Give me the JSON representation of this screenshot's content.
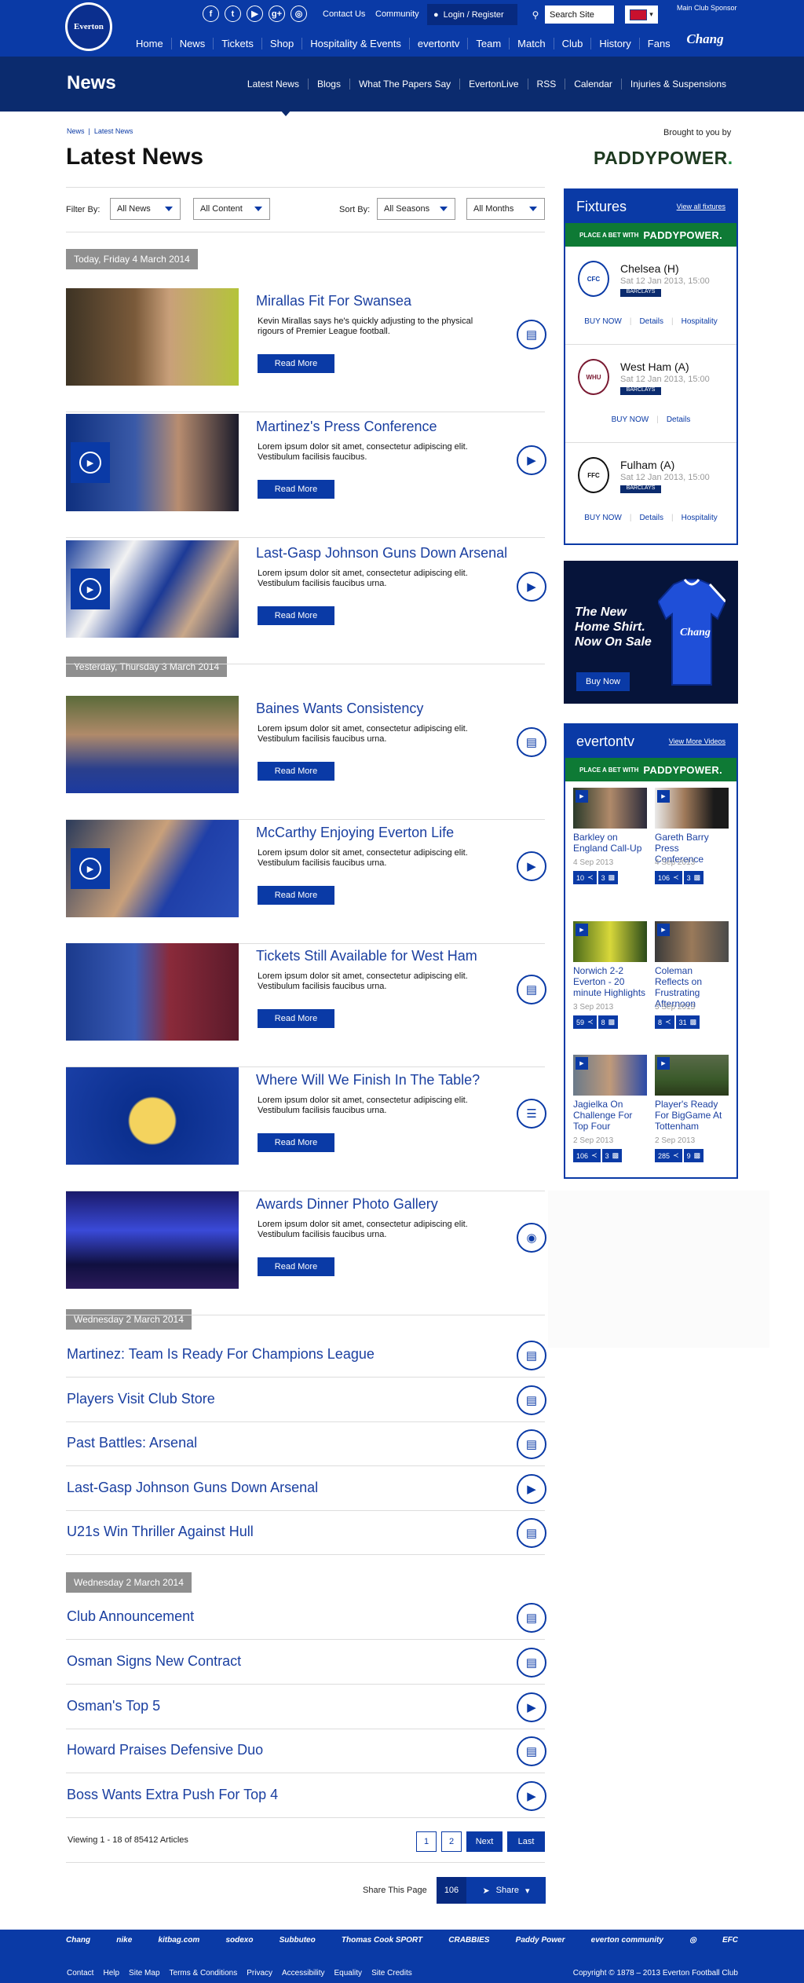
{
  "header": {
    "crest_text": "Everton",
    "social": [
      "f",
      "t",
      "▶",
      "g+",
      "◎"
    ],
    "contact_us": "Contact Us",
    "community": "Community",
    "login": "Login / Register",
    "search_placeholder": "Search Site",
    "sponsor_label": "Main Club Sponsor",
    "sponsor": "Chang",
    "nav": [
      "Home",
      "News",
      "Tickets",
      "Shop",
      "Hospitality & Events",
      "evertontv",
      "Team",
      "Match",
      "Club",
      "History",
      "Fans"
    ]
  },
  "section": {
    "title": "News",
    "subnav": [
      "Latest News",
      "Blogs",
      "What The Papers Say",
      "EvertonLive",
      "RSS",
      "Calendar",
      "Injuries & Suspensions"
    ]
  },
  "breadcrumb": {
    "home": "News",
    "current": "Latest News"
  },
  "page_title": "Latest News",
  "brought_by": "Brought to you by",
  "brand": {
    "a": "PADDY",
    "b": "POWER",
    "dot": "."
  },
  "filters": {
    "filter_label": "Filter By:",
    "news": "All News",
    "content": "All Content",
    "sort_label": "Sort By:",
    "seasons": "All Seasons",
    "months": "All Months"
  },
  "groups": [
    {
      "label": "Today, Friday 4 March 2014"
    },
    {
      "label": "Yesterday, Thursday 3 March 2014"
    },
    {
      "label": "Wednesday 2 March 2014"
    },
    {
      "label": "Wednesday 2 March 2014"
    }
  ],
  "articles": [
    {
      "title": "Mirallas Fit For Swansea",
      "desc": "Kevin Mirallas says he's quickly adjusting to the physical rigours of Premier League football.",
      "icon": "article-icon"
    },
    {
      "title": "Martinez's Press Conference",
      "desc": "Lorem ipsum dolor sit amet, consectetur adipiscing elit. Vestibulum facilisis faucibus.",
      "icon": "play-icon"
    },
    {
      "title": "Last-Gasp Johnson Guns Down Arsenal",
      "desc": "Lorem ipsum dolor sit amet, consectetur adipiscing elit. Vestibulum facilisis faucibus urna.",
      "icon": "play-icon"
    },
    {
      "title": "Baines Wants Consistency",
      "desc": "Lorem ipsum dolor sit amet, consectetur adipiscing elit. Vestibulum facilisis faucibus urna.",
      "icon": "article-icon"
    },
    {
      "title": "McCarthy Enjoying Everton Life",
      "desc": "Lorem ipsum dolor sit amet, consectetur adipiscing elit. Vestibulum facilisis faucibus urna.",
      "icon": "play-icon"
    },
    {
      "title": "Tickets Still Available for West Ham",
      "desc": "Lorem ipsum dolor sit amet, consectetur adipiscing elit. Vestibulum facilisis faucibus urna.",
      "icon": "article-icon"
    },
    {
      "title": "Where Will We Finish In The Table?",
      "desc": "Lorem ipsum dolor sit amet, consectetur adipiscing elit. Vestibulum facilisis faucibus urna.",
      "icon": "poll-icon"
    },
    {
      "title": "Awards Dinner Photo Gallery",
      "desc": "Lorem ipsum dolor sit amet, consectetur adipiscing elit. Vestibulum facilisis faucibus urna.",
      "icon": "camera-icon"
    }
  ],
  "read_more": "Read More",
  "list1": [
    {
      "title": "Martinez: Team Is Ready For Champions League",
      "icon": "article-icon"
    },
    {
      "title": "Players Visit Club Store",
      "icon": "article-icon"
    },
    {
      "title": "Past Battles: Arsenal",
      "icon": "article-icon"
    },
    {
      "title": "Last-Gasp Johnson Guns Down Arsenal",
      "icon": "play-icon"
    },
    {
      "title": "U21s Win Thriller Against Hull",
      "icon": "article-icon"
    }
  ],
  "list2": [
    {
      "title": "Club Announcement",
      "icon": "article-icon"
    },
    {
      "title": "Osman Signs New Contract",
      "icon": "article-icon"
    },
    {
      "title": "Osman's Top 5",
      "icon": "play-icon"
    },
    {
      "title": "Howard Praises Defensive Duo",
      "icon": "article-icon"
    },
    {
      "title": "Boss Wants Extra Push For Top 4",
      "icon": "play-icon"
    }
  ],
  "pagination": {
    "viewing": "Viewing 1 - 18 of 85412 Articles",
    "p1": "1",
    "p2": "2",
    "next": "Next",
    "last": "Last"
  },
  "share": {
    "label": "Share This Page",
    "count": "106",
    "button": "Share"
  },
  "fixtures": {
    "title": "Fixtures",
    "view_all": "View all fixtures",
    "bet": "PLACE A BET WITH",
    "bpl": "BARCLAYS",
    "items": [
      {
        "team": "Chelsea (H)",
        "date": "Sat 12 Jan 2013, 15:00",
        "logo": "CFC",
        "buy": "BUY NOW",
        "details": "Details",
        "hospitality": "Hospitality"
      },
      {
        "team": "West Ham (A)",
        "date": "Sat 12 Jan 2013, 15:00",
        "logo": "WHU",
        "buy": "BUY NOW",
        "details": "Details",
        "hospitality": ""
      },
      {
        "team": "Fulham (A)",
        "date": "Sat 12 Jan 2013, 15:00",
        "logo": "FFC",
        "buy": "BUY NOW",
        "details": "Details",
        "hospitality": "Hospitality"
      }
    ]
  },
  "shirt_ad": {
    "line1": "The New",
    "line2": "Home Shirt.",
    "line3": "Now On Sale",
    "buy": "Buy Now",
    "chest": "Chang"
  },
  "evertontv": {
    "title": "evertontv",
    "view_more": "View More Videos",
    "bet": "PLACE A BET WITH",
    "items": [
      {
        "title": "Barkley on England Call-Up",
        "date": "4 Sep 2013",
        "views": "10",
        "comments": "3"
      },
      {
        "title": "Gareth Barry Press Conference",
        "date": "4 Sep 2013",
        "views": "106",
        "comments": "3"
      },
      {
        "title": "Norwich 2-2 Everton - 20 minute Highlights",
        "date": "3 Sep 2013",
        "views": "59",
        "comments": "8"
      },
      {
        "title": "Coleman Reflects on Frustrating Afternoon",
        "date": "3 Sep 2013",
        "views": "8",
        "comments": "31"
      },
      {
        "title": "Jagielka On Challenge For Top Four",
        "date": "2 Sep 2013",
        "views": "106",
        "comments": "3"
      },
      {
        "title": "Player's Ready For BigGame At Tottenham",
        "date": "2 Sep 2013",
        "views": "285",
        "comments": "9"
      }
    ]
  },
  "footer": {
    "sponsors": [
      "Chang",
      "nike",
      "kitbag.com",
      "sodexo",
      "Subbuteo",
      "Thomas Cook SPORT",
      "CRABBIES",
      "Paddy Power",
      "everton community",
      "◎",
      "EFC"
    ],
    "links": [
      "Contact",
      "Help",
      "Site Map",
      "Terms & Conditions",
      "Privacy",
      "Accessibility",
      "Equality",
      "Site Credits"
    ],
    "copyright": "Copyright © 1878 – 2013 Everton Football Club"
  }
}
